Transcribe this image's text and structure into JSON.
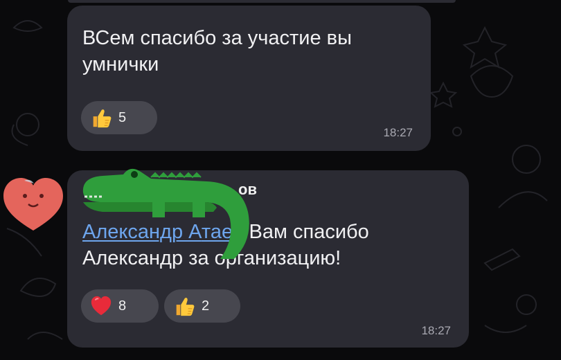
{
  "messages": [
    {
      "text_line1": "ВСем спасибо за участие вы",
      "text_line2": "умнички",
      "reactions": [
        {
          "emoji": "thumbs-up",
          "count": "5"
        }
      ],
      "time": "18:27"
    },
    {
      "sender_visible": "ов",
      "mention_part1": "Александр А",
      "mention_part2": "таев",
      "text_line1_rest": " Вам спасибо",
      "text_line2": "Александр за организацию!",
      "reactions": [
        {
          "emoji": "heart",
          "count": "8"
        },
        {
          "emoji": "thumbs-up",
          "count": "2"
        }
      ],
      "time": "18:27"
    }
  ],
  "colors": {
    "background": "#0a0a0c",
    "bubble": "#2b2b33",
    "reaction_pill": "#47474f",
    "mention": "#6ea6ee",
    "avatar": "#e4655c",
    "sticker_crocodile": "#2f9e3c"
  },
  "icons": [
    "thumbs-up-icon",
    "heart-icon",
    "heart-avatar-icon",
    "crocodile-sticker-icon"
  ]
}
